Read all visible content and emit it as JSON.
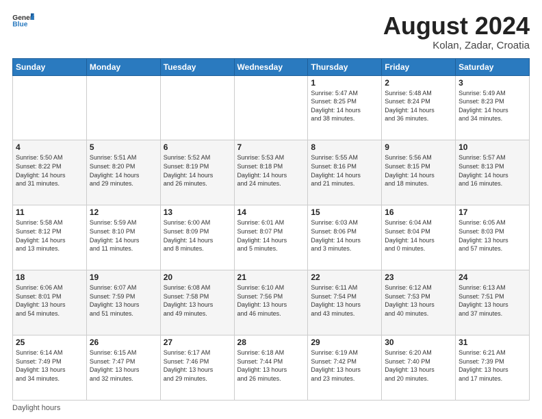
{
  "header": {
    "logo": {
      "line1": "General",
      "line2": "Blue"
    },
    "title": "August 2024",
    "subtitle": "Kolan, Zadar, Croatia"
  },
  "calendar": {
    "weekdays": [
      "Sunday",
      "Monday",
      "Tuesday",
      "Wednesday",
      "Thursday",
      "Friday",
      "Saturday"
    ],
    "weeks": [
      [
        {
          "day": "",
          "info": ""
        },
        {
          "day": "",
          "info": ""
        },
        {
          "day": "",
          "info": ""
        },
        {
          "day": "",
          "info": ""
        },
        {
          "day": "1",
          "info": "Sunrise: 5:47 AM\nSunset: 8:25 PM\nDaylight: 14 hours\nand 38 minutes."
        },
        {
          "day": "2",
          "info": "Sunrise: 5:48 AM\nSunset: 8:24 PM\nDaylight: 14 hours\nand 36 minutes."
        },
        {
          "day": "3",
          "info": "Sunrise: 5:49 AM\nSunset: 8:23 PM\nDaylight: 14 hours\nand 34 minutes."
        }
      ],
      [
        {
          "day": "4",
          "info": "Sunrise: 5:50 AM\nSunset: 8:22 PM\nDaylight: 14 hours\nand 31 minutes."
        },
        {
          "day": "5",
          "info": "Sunrise: 5:51 AM\nSunset: 8:20 PM\nDaylight: 14 hours\nand 29 minutes."
        },
        {
          "day": "6",
          "info": "Sunrise: 5:52 AM\nSunset: 8:19 PM\nDaylight: 14 hours\nand 26 minutes."
        },
        {
          "day": "7",
          "info": "Sunrise: 5:53 AM\nSunset: 8:18 PM\nDaylight: 14 hours\nand 24 minutes."
        },
        {
          "day": "8",
          "info": "Sunrise: 5:55 AM\nSunset: 8:16 PM\nDaylight: 14 hours\nand 21 minutes."
        },
        {
          "day": "9",
          "info": "Sunrise: 5:56 AM\nSunset: 8:15 PM\nDaylight: 14 hours\nand 18 minutes."
        },
        {
          "day": "10",
          "info": "Sunrise: 5:57 AM\nSunset: 8:13 PM\nDaylight: 14 hours\nand 16 minutes."
        }
      ],
      [
        {
          "day": "11",
          "info": "Sunrise: 5:58 AM\nSunset: 8:12 PM\nDaylight: 14 hours\nand 13 minutes."
        },
        {
          "day": "12",
          "info": "Sunrise: 5:59 AM\nSunset: 8:10 PM\nDaylight: 14 hours\nand 11 minutes."
        },
        {
          "day": "13",
          "info": "Sunrise: 6:00 AM\nSunset: 8:09 PM\nDaylight: 14 hours\nand 8 minutes."
        },
        {
          "day": "14",
          "info": "Sunrise: 6:01 AM\nSunset: 8:07 PM\nDaylight: 14 hours\nand 5 minutes."
        },
        {
          "day": "15",
          "info": "Sunrise: 6:03 AM\nSunset: 8:06 PM\nDaylight: 14 hours\nand 3 minutes."
        },
        {
          "day": "16",
          "info": "Sunrise: 6:04 AM\nSunset: 8:04 PM\nDaylight: 14 hours\nand 0 minutes."
        },
        {
          "day": "17",
          "info": "Sunrise: 6:05 AM\nSunset: 8:03 PM\nDaylight: 13 hours\nand 57 minutes."
        }
      ],
      [
        {
          "day": "18",
          "info": "Sunrise: 6:06 AM\nSunset: 8:01 PM\nDaylight: 13 hours\nand 54 minutes."
        },
        {
          "day": "19",
          "info": "Sunrise: 6:07 AM\nSunset: 7:59 PM\nDaylight: 13 hours\nand 51 minutes."
        },
        {
          "day": "20",
          "info": "Sunrise: 6:08 AM\nSunset: 7:58 PM\nDaylight: 13 hours\nand 49 minutes."
        },
        {
          "day": "21",
          "info": "Sunrise: 6:10 AM\nSunset: 7:56 PM\nDaylight: 13 hours\nand 46 minutes."
        },
        {
          "day": "22",
          "info": "Sunrise: 6:11 AM\nSunset: 7:54 PM\nDaylight: 13 hours\nand 43 minutes."
        },
        {
          "day": "23",
          "info": "Sunrise: 6:12 AM\nSunset: 7:53 PM\nDaylight: 13 hours\nand 40 minutes."
        },
        {
          "day": "24",
          "info": "Sunrise: 6:13 AM\nSunset: 7:51 PM\nDaylight: 13 hours\nand 37 minutes."
        }
      ],
      [
        {
          "day": "25",
          "info": "Sunrise: 6:14 AM\nSunset: 7:49 PM\nDaylight: 13 hours\nand 34 minutes."
        },
        {
          "day": "26",
          "info": "Sunrise: 6:15 AM\nSunset: 7:47 PM\nDaylight: 13 hours\nand 32 minutes."
        },
        {
          "day": "27",
          "info": "Sunrise: 6:17 AM\nSunset: 7:46 PM\nDaylight: 13 hours\nand 29 minutes."
        },
        {
          "day": "28",
          "info": "Sunrise: 6:18 AM\nSunset: 7:44 PM\nDaylight: 13 hours\nand 26 minutes."
        },
        {
          "day": "29",
          "info": "Sunrise: 6:19 AM\nSunset: 7:42 PM\nDaylight: 13 hours\nand 23 minutes."
        },
        {
          "day": "30",
          "info": "Sunrise: 6:20 AM\nSunset: 7:40 PM\nDaylight: 13 hours\nand 20 minutes."
        },
        {
          "day": "31",
          "info": "Sunrise: 6:21 AM\nSunset: 7:39 PM\nDaylight: 13 hours\nand 17 minutes."
        }
      ]
    ]
  },
  "footer": {
    "label": "Daylight hours"
  }
}
